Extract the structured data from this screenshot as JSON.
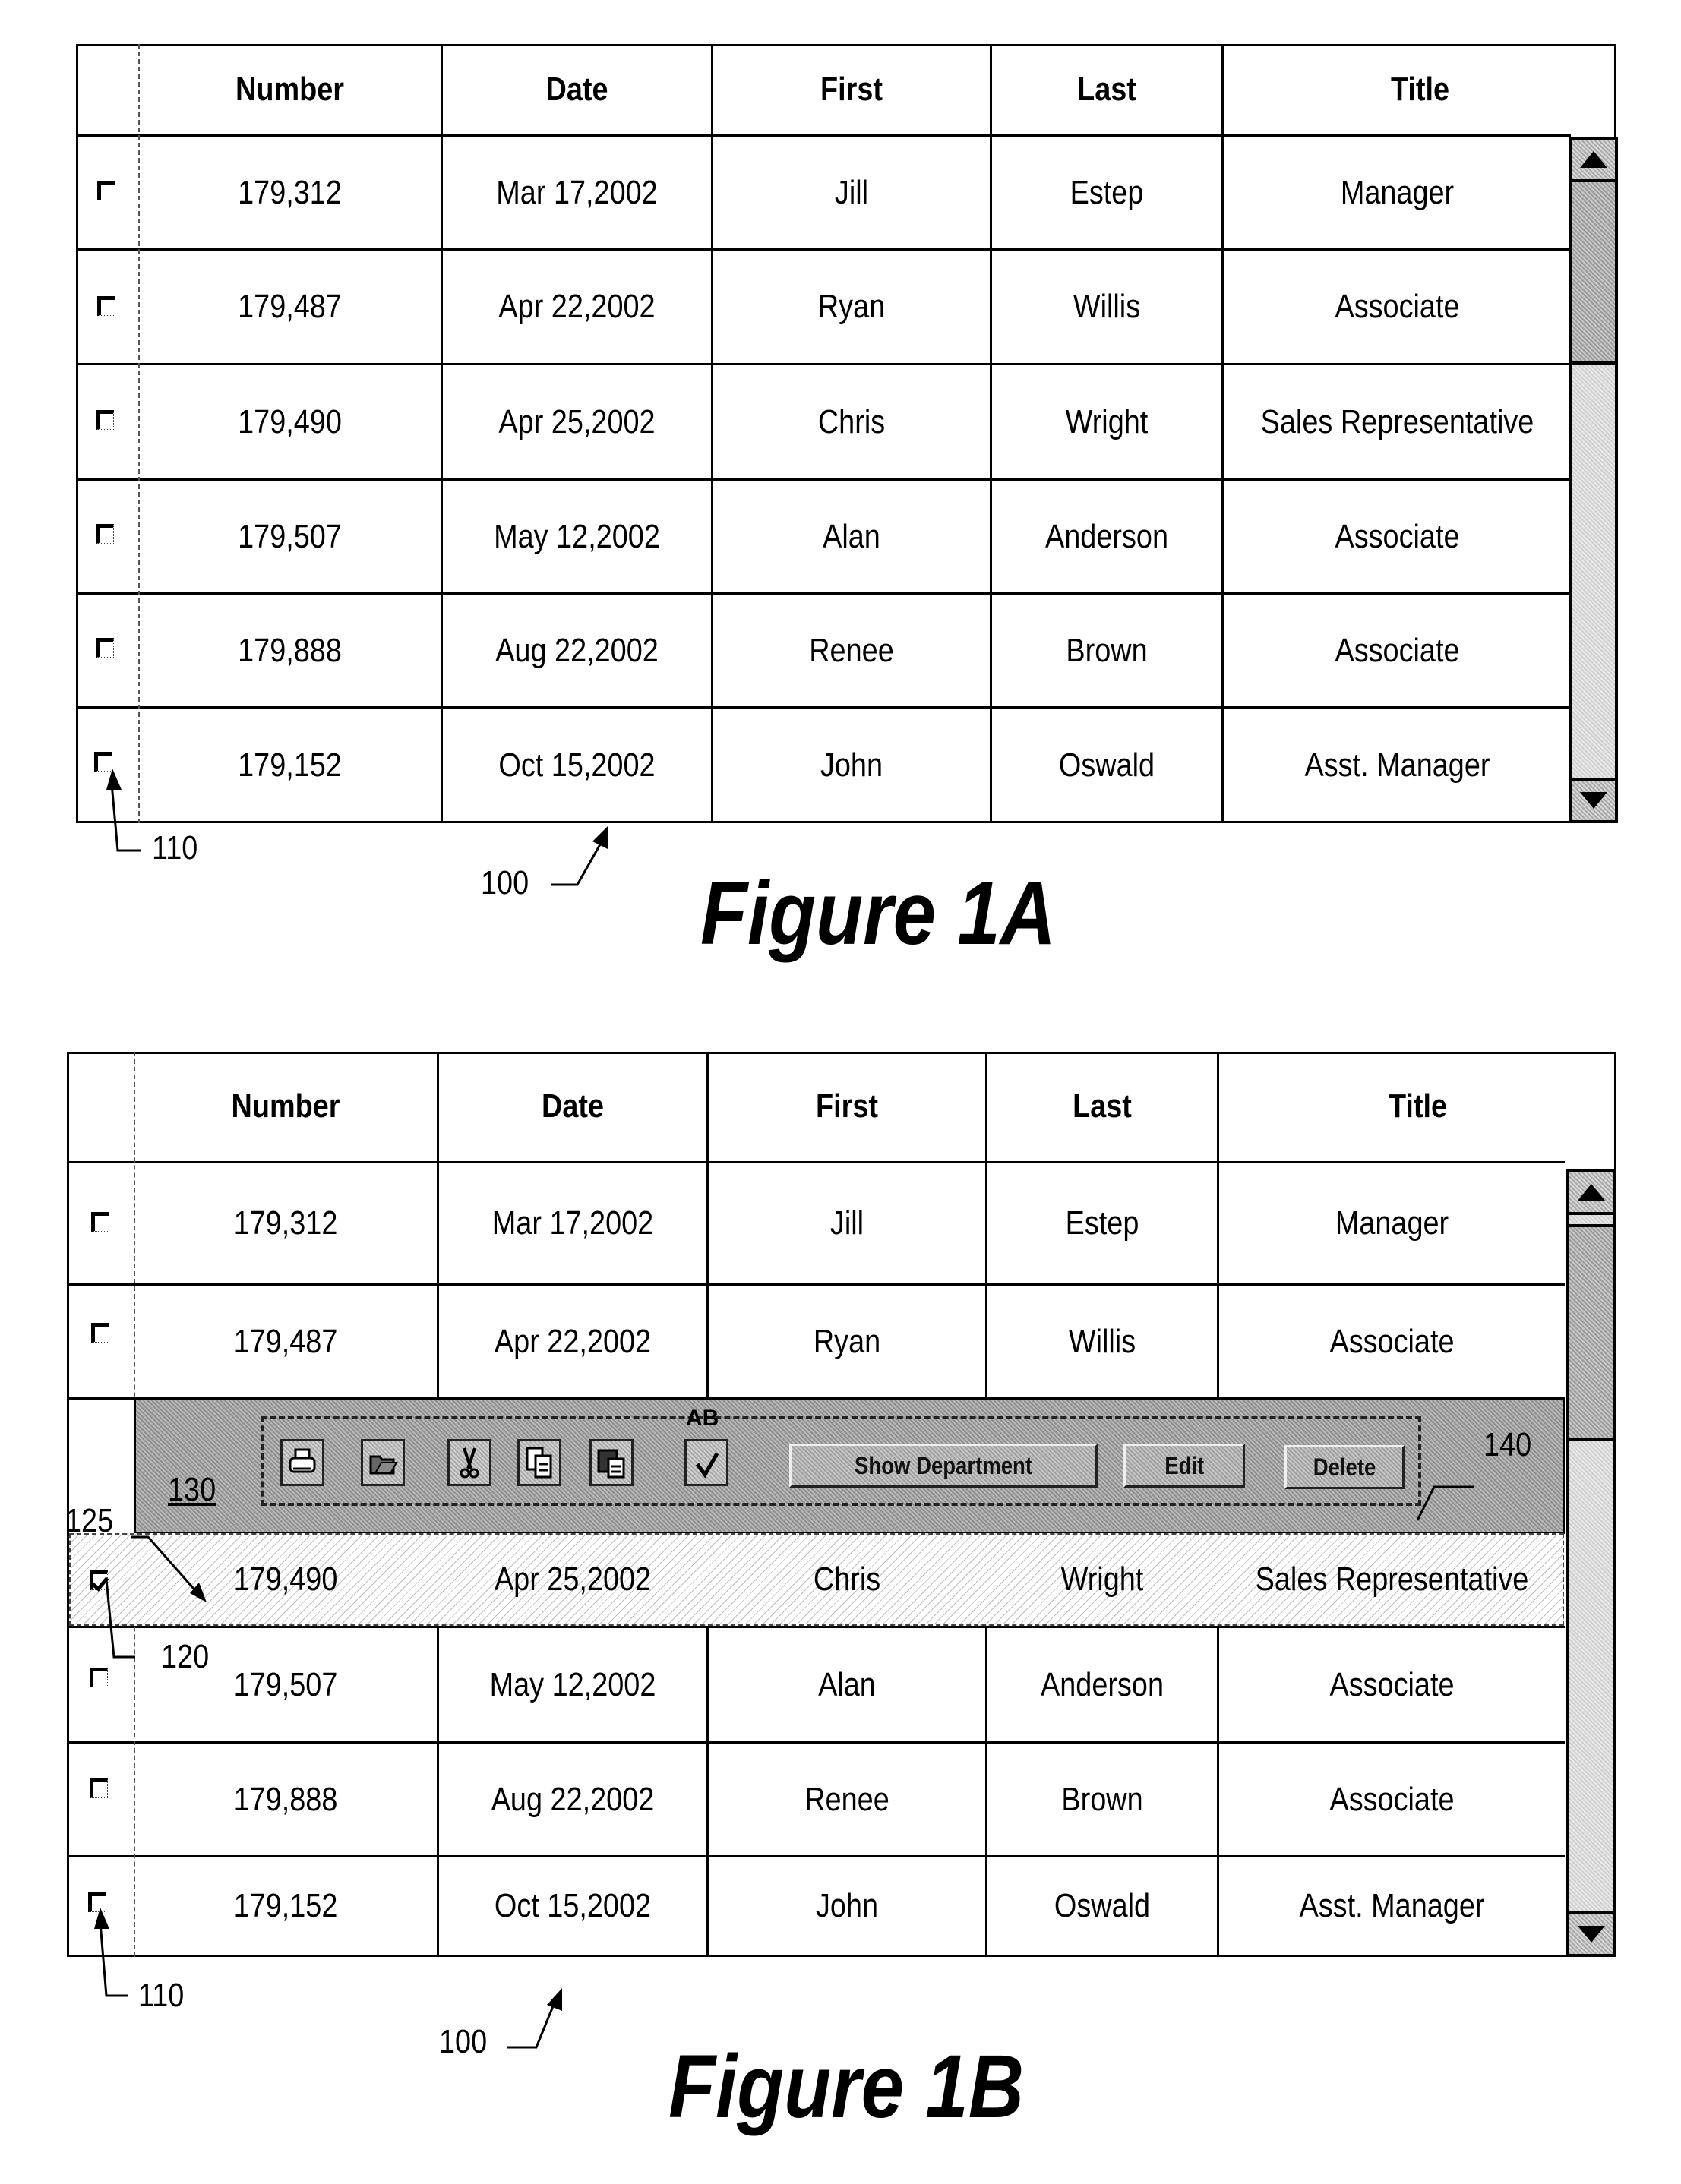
{
  "columns": [
    "Number",
    "Date",
    "First",
    "Last",
    "Title"
  ],
  "rows": [
    {
      "number": "179,312",
      "date": "Mar 17,2002",
      "first": "Jill",
      "last": "Estep",
      "title": "Manager"
    },
    {
      "number": "179,487",
      "date": "Apr 22,2002",
      "first": "Ryan",
      "last": "Willis",
      "title": "Associate"
    },
    {
      "number": "179,490",
      "date": "Apr 25,2002",
      "first": "Chris",
      "last": "Wright",
      "title": "Sales Representative"
    },
    {
      "number": "179,507",
      "date": "May 12,2002",
      "first": "Alan",
      "last": "Anderson",
      "title": "Associate"
    },
    {
      "number": "179,888",
      "date": "Aug 22,2002",
      "first": "Renee",
      "last": "Brown",
      "title": "Associate"
    },
    {
      "number": "179,152",
      "date": "Oct 15,2002",
      "first": "John",
      "last": "Oswald",
      "title": "Asst. Manager"
    }
  ],
  "figure_a": {
    "caption": "Figure 1A",
    "ref_table": "100",
    "ref_checkbox": "110",
    "checked": [
      false,
      false,
      false,
      false,
      false,
      false
    ]
  },
  "figure_b": {
    "caption": "Figure 1B",
    "ref_table": "100",
    "ref_checkbox": "110",
    "ref_selected_checkbox": "120",
    "ref_selected_row": "125",
    "ref_toolbar": "130",
    "ref_button_group": "140",
    "selected_row_index": 2,
    "checked": [
      false,
      false,
      true,
      false,
      false,
      false
    ],
    "toolbar": {
      "icons": [
        "print-icon",
        "open-folder-icon",
        "cut-icon",
        "copy-icon",
        "paste-icon",
        "spell-check-icon"
      ],
      "spell_check_label": "AB",
      "buttons": [
        "Show Department",
        "Edit",
        "Delete"
      ]
    }
  }
}
